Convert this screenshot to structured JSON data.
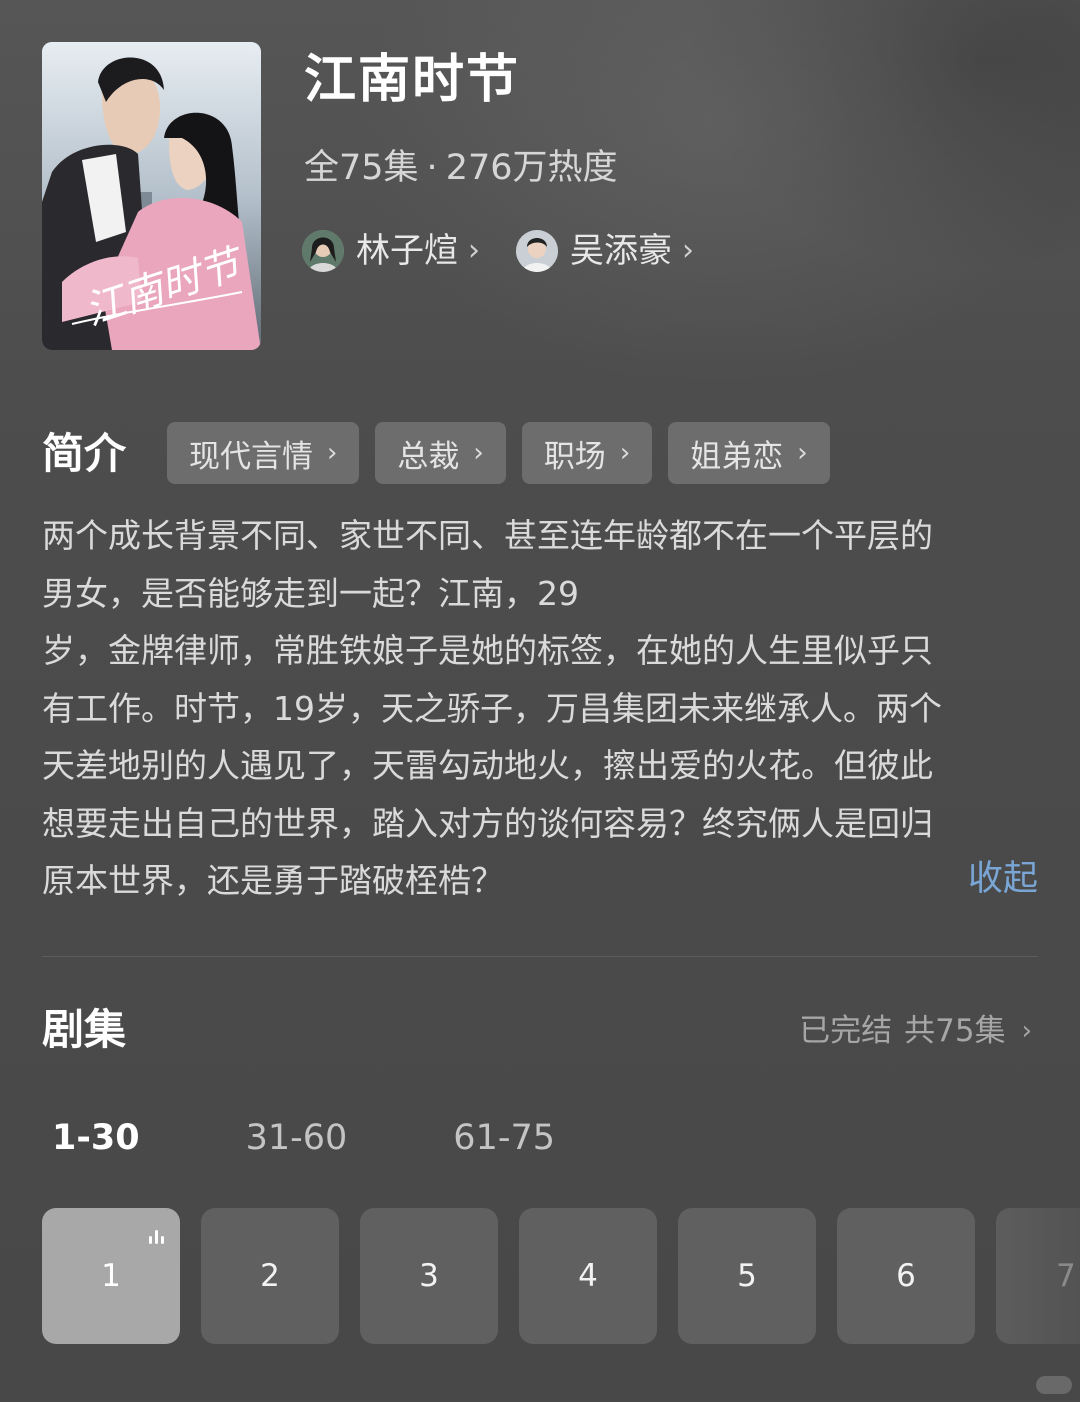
{
  "drama": {
    "title": "江南时节",
    "episodes_total_label": "全75集",
    "meta_separator": "·",
    "popularity": "276万热度"
  },
  "poster": {
    "title_art_text": "江南时节"
  },
  "actors": [
    {
      "name": "林子煊"
    },
    {
      "name": "吴添豪"
    }
  ],
  "intro": {
    "heading": "简介",
    "tags": [
      "现代言情",
      "总裁",
      "职场",
      "姐弟恋"
    ],
    "lines": [
      "两个成长背景不同、家世不同、甚至连年龄都不在一个平层的",
      "男女，是否能够走到一起？江南，29",
      "岁，金牌律师，常胜铁娘子是她的标签，在她的人生里似乎只",
      "有工作。时节，19岁，天之骄子，万昌集团未来继承人。两个",
      "天差地别的人遇见了，天雷勾动地火，擦出爱的火花。但彼此",
      "想要走出自己的世界，踏入对方的谈何容易？终究俩人是回归",
      "原本世界，还是勇于踏破桎梏？"
    ],
    "collapse_label": "收起"
  },
  "episodes": {
    "heading": "剧集",
    "status": "已完结",
    "count_label": "共75集",
    "ranges": [
      "1-30",
      "31-60",
      "61-75"
    ],
    "active_range": 0,
    "visible": [
      "1",
      "2",
      "3",
      "4",
      "5",
      "6",
      "7"
    ],
    "current": "1"
  },
  "icons": {
    "actor_chevron": "chevron-right-icon",
    "tag_chevron": "chevron-right-icon",
    "playing": "playing-bars-icon"
  },
  "colors": {
    "background": "#494949",
    "link": "#7aa6d6",
    "tag_bg": "#6d6d6d",
    "episode_bg": "#606060",
    "episode_current_bg": "#a8a8a8"
  }
}
